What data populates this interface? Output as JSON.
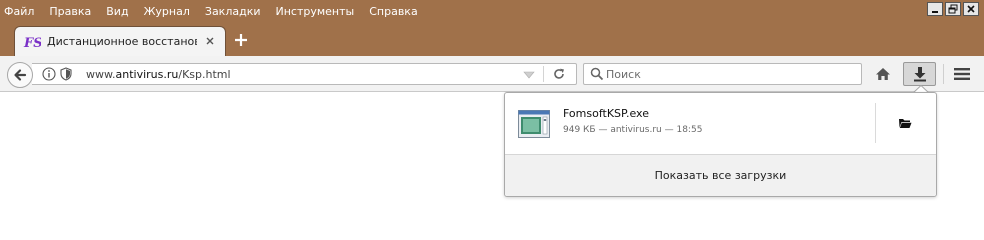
{
  "menu": [
    {
      "label": "Файл"
    },
    {
      "label": "Правка"
    },
    {
      "label": "Вид"
    },
    {
      "label": "Журнал"
    },
    {
      "label": "Закладки"
    },
    {
      "label": "Инструменты"
    },
    {
      "label": "Справка"
    }
  ],
  "tab": {
    "title": "Дистанционное восстановл...",
    "favicon_text": "FS"
  },
  "url": {
    "prefix": "www.",
    "host": "antivirus.ru",
    "path": "/Ksp.html"
  },
  "search": {
    "placeholder": "Поиск"
  },
  "downloads": {
    "items": [
      {
        "file_name": "FomsoftKSP.exe",
        "status": "949 КБ — antivirus.ru — 18:55"
      }
    ],
    "show_all_label": "Показать все загрузки"
  },
  "colors": {
    "title_bar": "#a0714a",
    "toolbar": "#f2f2f2",
    "favicon": "#7a2fc7"
  },
  "icons": [
    "info-icon",
    "shield-icon",
    "reload-icon",
    "search-icon",
    "home-icon",
    "download-icon",
    "hamburger-menu-icon",
    "folder-icon",
    "executable-file-icon"
  ]
}
